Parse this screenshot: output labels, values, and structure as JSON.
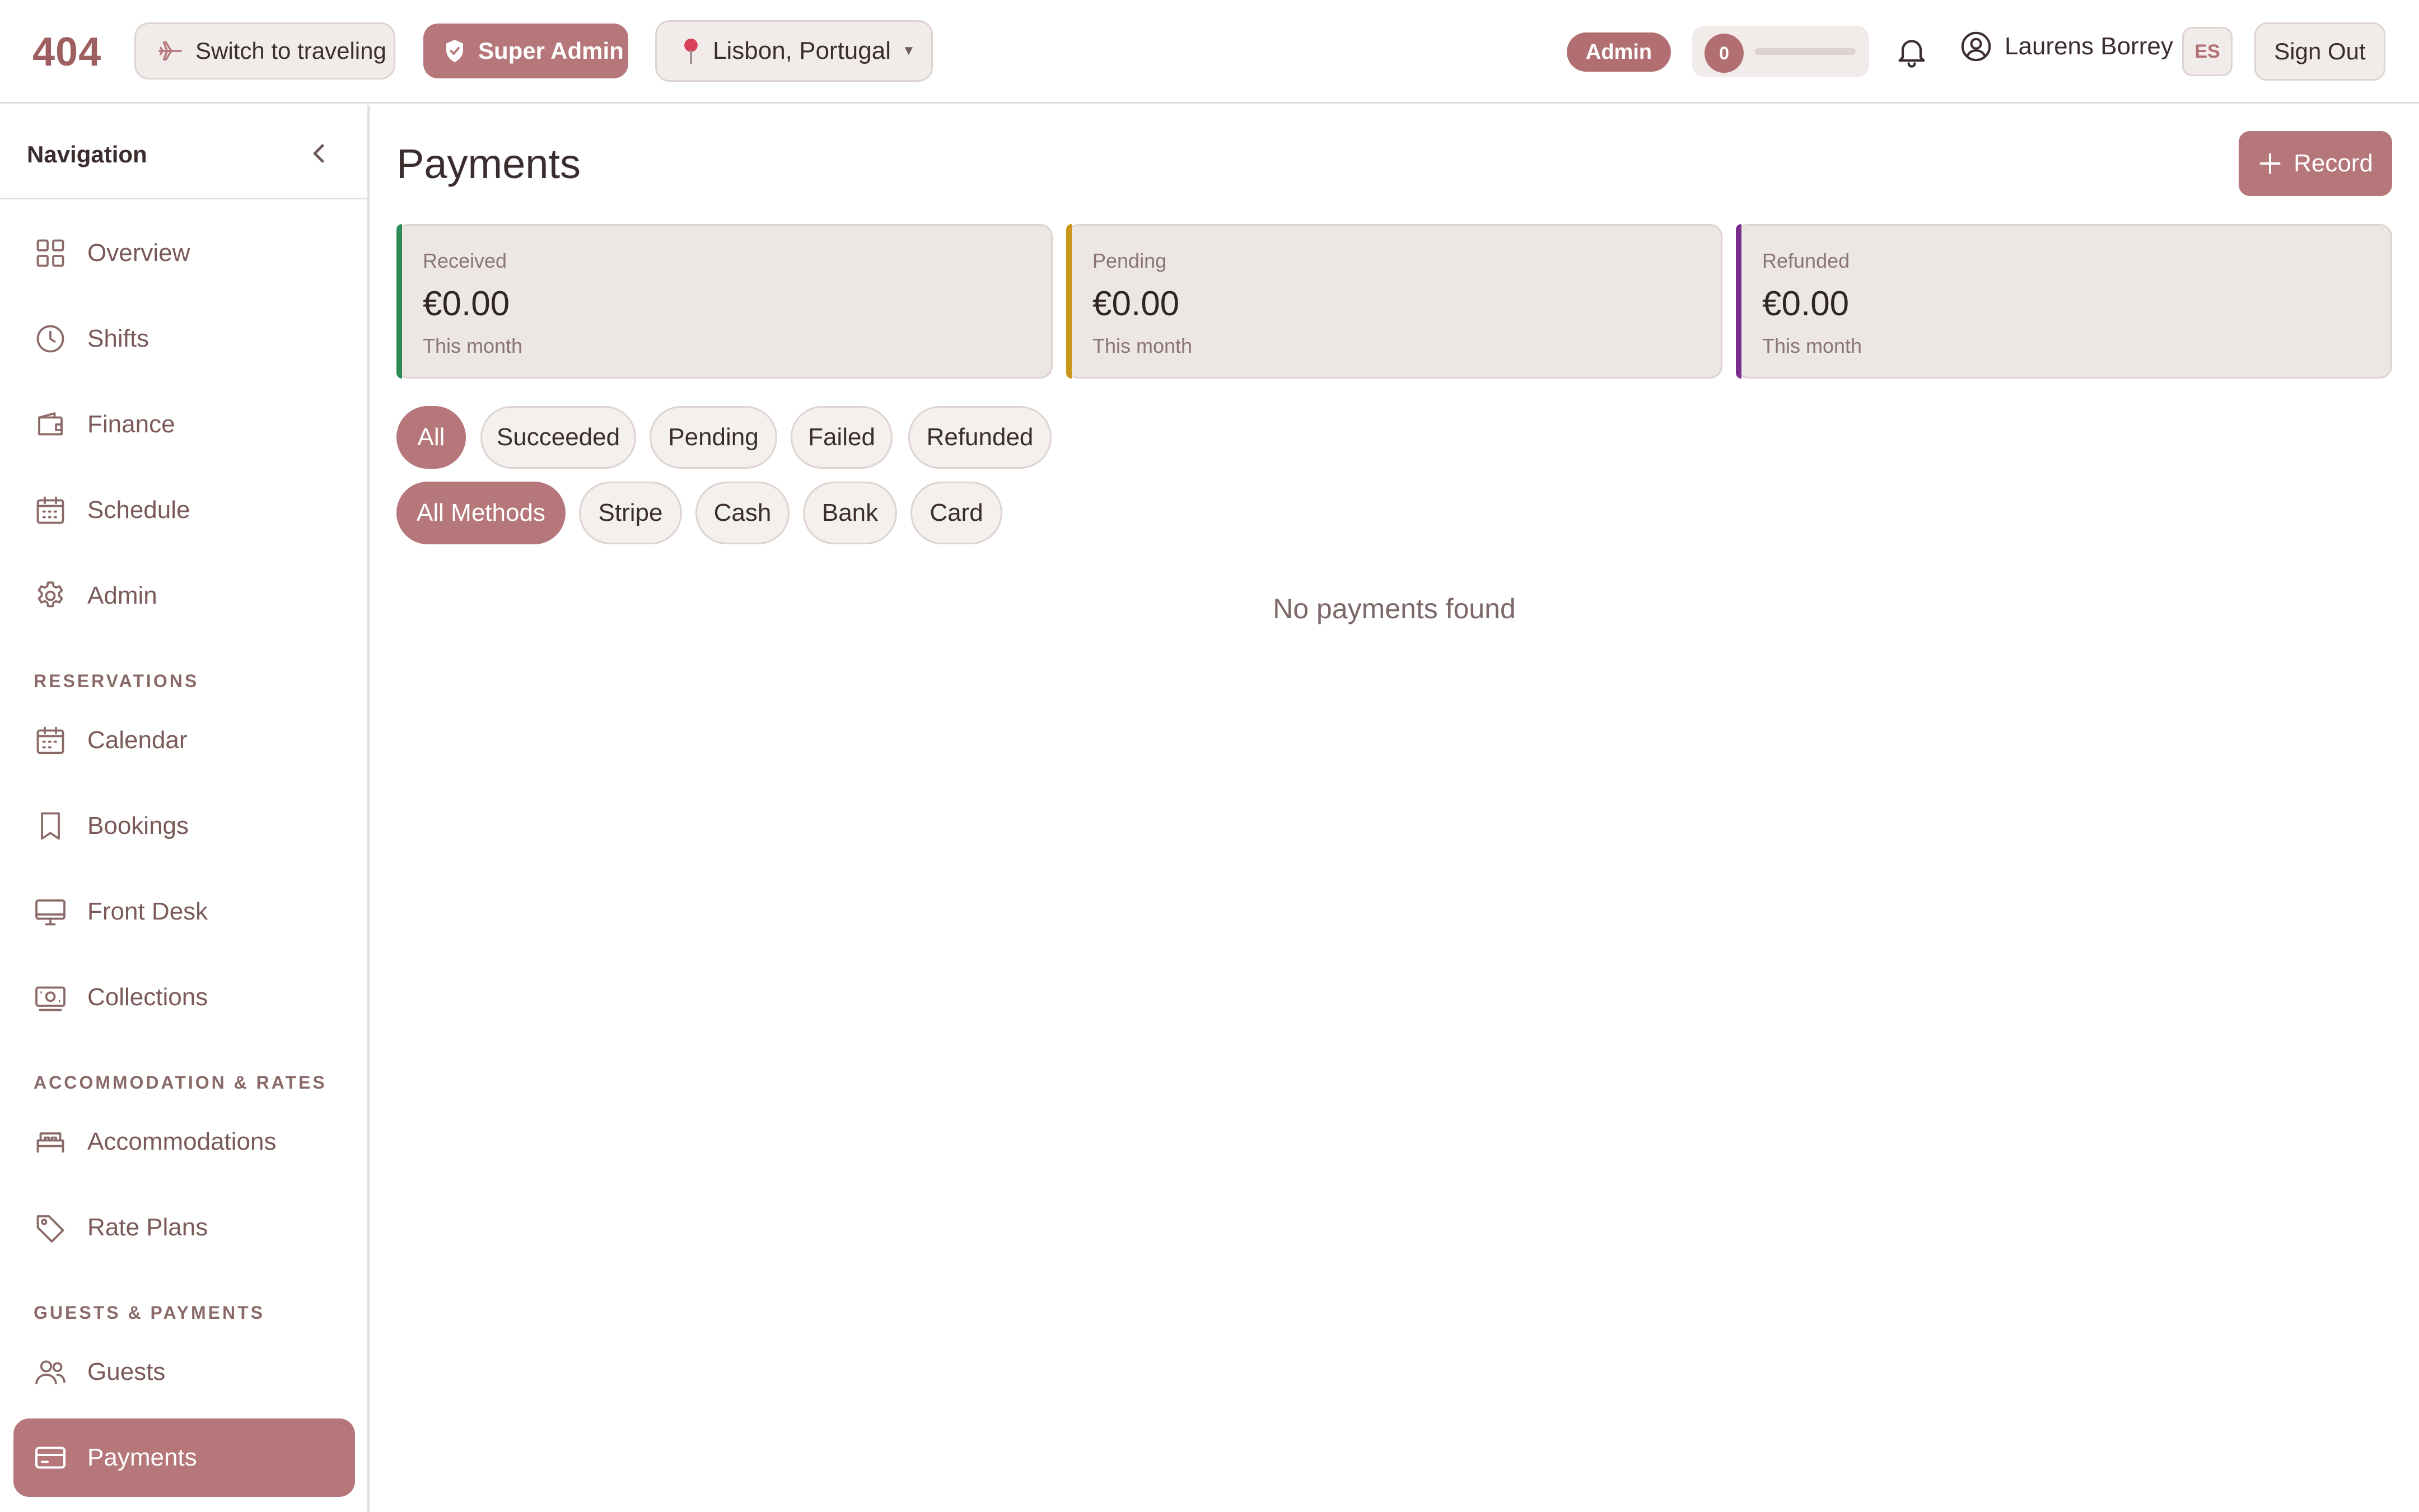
{
  "app": {
    "logo": "404"
  },
  "header": {
    "switch_label": "Switch to traveling",
    "super_admin_label": "Super Admin",
    "location": "Lisbon, Portugal",
    "role_badge": "Admin",
    "progress_count": "0",
    "progress_fraction": 0,
    "user_name": "Laurens Borrey",
    "language": "ES",
    "sign_out": "Sign Out"
  },
  "sidebar": {
    "title": "Navigation",
    "main_items": [
      {
        "label": "Overview",
        "icon": "grid-icon"
      },
      {
        "label": "Shifts",
        "icon": "clock-icon"
      },
      {
        "label": "Finance",
        "icon": "wallet-icon"
      },
      {
        "label": "Schedule",
        "icon": "calendar-grid-icon"
      },
      {
        "label": "Admin",
        "icon": "gear-icon"
      }
    ],
    "sections": [
      {
        "title": "RESERVATIONS",
        "items": [
          {
            "label": "Calendar",
            "icon": "calendar-icon"
          },
          {
            "label": "Bookings",
            "icon": "bookmark-icon"
          },
          {
            "label": "Front Desk",
            "icon": "monitor-icon"
          },
          {
            "label": "Collections",
            "icon": "banknote-icon"
          }
        ]
      },
      {
        "title": "ACCOMMODATION & RATES",
        "items": [
          {
            "label": "Accommodations",
            "icon": "bed-icon"
          },
          {
            "label": "Rate Plans",
            "icon": "tag-icon"
          }
        ]
      },
      {
        "title": "GUESTS & PAYMENTS",
        "items": [
          {
            "label": "Guests",
            "icon": "users-icon"
          },
          {
            "label": "Payments",
            "icon": "credit-card-icon",
            "active": true
          }
        ]
      }
    ]
  },
  "main": {
    "title": "Payments",
    "record_label": "Record",
    "cards": [
      {
        "label": "Received",
        "value": "€0.00",
        "sub": "This month",
        "accent": "#2e8b57"
      },
      {
        "label": "Pending",
        "value": "€0.00",
        "sub": "This month",
        "accent": "#c9961a"
      },
      {
        "label": "Refunded",
        "value": "€0.00",
        "sub": "This month",
        "accent": "#7b2d8e"
      }
    ],
    "status_filters": [
      "All",
      "Succeeded",
      "Pending",
      "Failed",
      "Refunded"
    ],
    "active_status": "All",
    "method_filters": [
      "All Methods",
      "Stripe",
      "Cash",
      "Bank",
      "Card"
    ],
    "active_method": "All Methods",
    "empty_message": "No payments found"
  },
  "colors": {
    "accent": "#b6777a",
    "logo": "#9e5f60",
    "card_bg": "#ede7e4",
    "border": "#ddd3d1"
  }
}
